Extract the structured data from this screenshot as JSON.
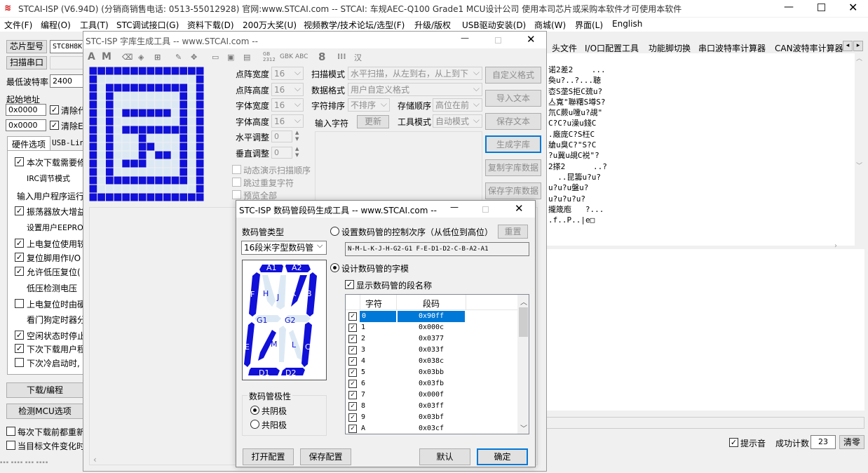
{
  "main_window": {
    "title": "STCAI-ISP (V6.94D) (分销商销售电话: 0513-55012928) 官网:www.STCAI.com  -- STCAI: 车规AEC-Q100 Grade1 MCU设计公司 使用本司芯片或采购本软件才可使用本软件",
    "menu": [
      "文件(F)",
      "编程(O)",
      "工具(T)",
      "STC调试接口(G)",
      "资料下载(D)",
      "200万大奖(U)",
      "视频教学/技术论坛/选型(F)",
      "升级/版权",
      "USB驱动安装(D)",
      "商城(W)",
      "界面(L)",
      "English"
    ],
    "chip_btn": "芯片型号",
    "chip_val": "STC8H8K",
    "scan_btn": "扫描串口",
    "baud_lbl": "最低波特率",
    "baud_val": "2400",
    "start_lbl": "起始地址",
    "addr1": "0x0000",
    "clear1": "清除代",
    "addr2": "0x0000",
    "clear2": "清除E",
    "tabs": [
      "硬件选项",
      "USB-Lin"
    ],
    "opts": [
      "本次下载需要修",
      "IRC调节模式",
      "输入用户程序运行",
      "振荡器放大增益",
      "设置用户EEPROM",
      "上电复位使用较",
      "复位脚用作I/O",
      "允许低压复位(",
      "低压检测电压",
      "上电复位时由硬",
      "看门狗定时器分",
      "空闲状态时停止",
      "下次下载用户程",
      "下次冷启动时,"
    ],
    "download_btn": "下载/编程",
    "detect_btn": "检测MCU选项",
    "every_lbl": "每次下载前都重新",
    "auto_lbl": "当目标文件变化时",
    "right_tabs": [
      "头文件",
      "I/O口配置工具",
      "功能脚切换",
      "串口波特率计算器",
      "CAN波特率计算器"
    ],
    "log_lines": [
      "诺2差2    ...",
      "奐u?..?...聴",
      "枩S垄S拒C巯u?",
      "亼寬\"聯糬S墫S?",
      "氘C蕨u嚔u?覘\"",
      "C?C?u澡u錢C",
      ".廠庞C?S枉C",
      "牄u臭C?\"S?C",
      "?u冀u覘C裞\"?",
      "2搽2      ..?",
      "  ..昆籌u?u?",
      "u?u?u盤u?",
      "u?u?u?u?",
      "攏筬庖   ?...",
      ".f..P..|e□"
    ],
    "sound_lbl": "提示音",
    "count_lbl": "成功计数",
    "count_val": "23",
    "clear_btn": "清零"
  },
  "font_window": {
    "title": "STC-ISP 字库生成工具 -- www.STCAI.com --",
    "toolbar_text": [
      "A",
      "M",
      "GB\n2312",
      "GBK",
      "ABC",
      "8",
      "汉"
    ],
    "fields": [
      {
        "label": "点阵宽度",
        "value": "16"
      },
      {
        "label": "点阵高度",
        "value": "16"
      },
      {
        "label": "字体宽度",
        "value": "16"
      },
      {
        "label": "字体高度",
        "value": "16"
      },
      {
        "label": "水平调整",
        "value": "0"
      },
      {
        "label": "垂直调整",
        "value": "0"
      }
    ],
    "scan_lbl": "扫描模式",
    "scan_val": "水平扫描，从左到右，从上到下",
    "data_lbl": "数据格式",
    "data_val": "用户自定义格式",
    "order_lbl": "字符排序",
    "order_val": "不排序",
    "store_lbl": "存储顺序",
    "store_val": "高位在前",
    "input_lbl": "输入字符",
    "update_btn": "更新",
    "mode_lbl": "工具模式",
    "mode_val": "自动模式",
    "checks": [
      "动态演示扫描顺序",
      "跳过重复字符",
      "预览全部"
    ],
    "buttons": [
      "自定义格式",
      "导入文本",
      "保存文本",
      "生成字库",
      "复制字库数据",
      "保存字库数据"
    ]
  },
  "seg_window": {
    "title": "STC-ISP 数码管段码生成工具 -- www.STCAI.com --",
    "type_lbl": "数码管类型",
    "type_val": "16段米字型数码管",
    "opt_order": "设置数码管的控制次序（从低位到高位）",
    "reset_btn": "重置",
    "order_str": "N-M-L-K-J-H-G2-G1  F-E-D1-D2-C-B-A2-A1",
    "opt_design": "设计数码管的字模",
    "show_names": "显示数码管的段名称",
    "col_char": "字符",
    "col_code": "段码",
    "rows": [
      {
        "c": "0",
        "v": "0x90ff"
      },
      {
        "c": "1",
        "v": "0x000c"
      },
      {
        "c": "2",
        "v": "0x0377"
      },
      {
        "c": "3",
        "v": "0x033f"
      },
      {
        "c": "4",
        "v": "0x038c"
      },
      {
        "c": "5",
        "v": "0x03bb"
      },
      {
        "c": "6",
        "v": "0x03fb"
      },
      {
        "c": "7",
        "v": "0x000f"
      },
      {
        "c": "8",
        "v": "0x03ff"
      },
      {
        "c": "9",
        "v": "0x03bf"
      },
      {
        "c": "A",
        "v": "0x03cf"
      }
    ],
    "polarity_lbl": "数码管极性",
    "cathode": "共阴极",
    "anode": "共阳极",
    "open_btn": "打开配置",
    "save_btn": "保存配置",
    "default_btn": "默认",
    "ok_btn": "确定",
    "seg_names": [
      "A1",
      "A2",
      "F",
      "H",
      "J",
      "K",
      "B",
      "G1",
      "G2",
      "E",
      "N",
      "M",
      "L",
      "C",
      "D1",
      "D2"
    ]
  },
  "colors": {
    "accent": "#0078d7",
    "segment": "#1010d8",
    "grid_on": "#1010d8",
    "grid_off": "#dce9f5"
  }
}
